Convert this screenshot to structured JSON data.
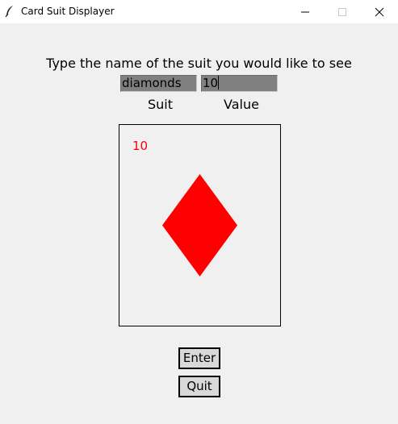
{
  "window": {
    "title": "Card Suit Displayer",
    "icon": "feather-icon",
    "controls": [
      "minimize-icon",
      "maximize-icon",
      "close-icon"
    ]
  },
  "form": {
    "prompt": "Type the name of the suit you would like to see",
    "suit_value": "diamonds",
    "value_value": "10",
    "suit_label": "Suit",
    "value_label": "Value"
  },
  "card": {
    "value": "10",
    "suit": "diamonds",
    "suit_icon": "diamond-icon",
    "color": "#ff0000"
  },
  "buttons": {
    "enter_label": "Enter",
    "quit_label": "Quit"
  }
}
